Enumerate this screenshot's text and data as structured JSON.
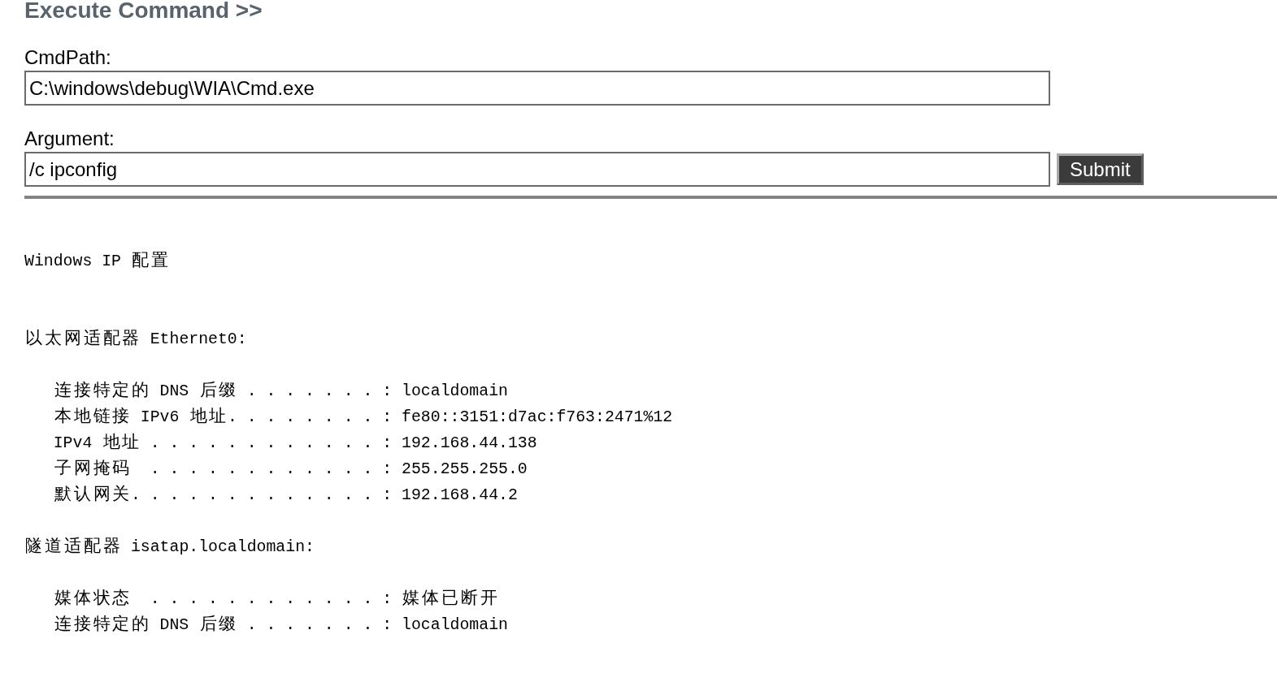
{
  "page": {
    "title": "Execute Command >>"
  },
  "form": {
    "fields": [
      {
        "label": "CmdPath:",
        "value": "C:\\windows\\debug\\WIA\\Cmd.exe"
      },
      {
        "label": "Argument:",
        "value": "/c ipconfig"
      }
    ],
    "submit_button": "Submit"
  },
  "output": {
    "title": "Windows IP 配置",
    "adapters": [
      {
        "name": "以太网适配器 Ethernet0:",
        "entries": [
          {
            "label": "连接特定的 DNS 后缀 . . . . . . . :",
            "value": "localdomain"
          },
          {
            "label": "本地链接 IPv6 地址. . . . . . . . :",
            "value": "fe80::3151:d7ac:f763:2471%12"
          },
          {
            "label": "IPv4 地址 . . . . . . . . . . . . :",
            "value": "192.168.44.138"
          },
          {
            "label": "子网掩码  . . . . . . . . . . . . :",
            "value": "255.255.255.0"
          },
          {
            "label": "默认网关. . . . . . . . . . . . . :",
            "value": "192.168.44.2"
          }
        ]
      },
      {
        "name": "隧道适配器 isatap.localdomain:",
        "entries": [
          {
            "label": "媒体状态  . . . . . . . . . . . . :",
            "value": "媒体已断开"
          },
          {
            "label": "连接特定的 DNS 后缀 . . . . . . . :",
            "value": "localdomain"
          }
        ]
      }
    ]
  }
}
